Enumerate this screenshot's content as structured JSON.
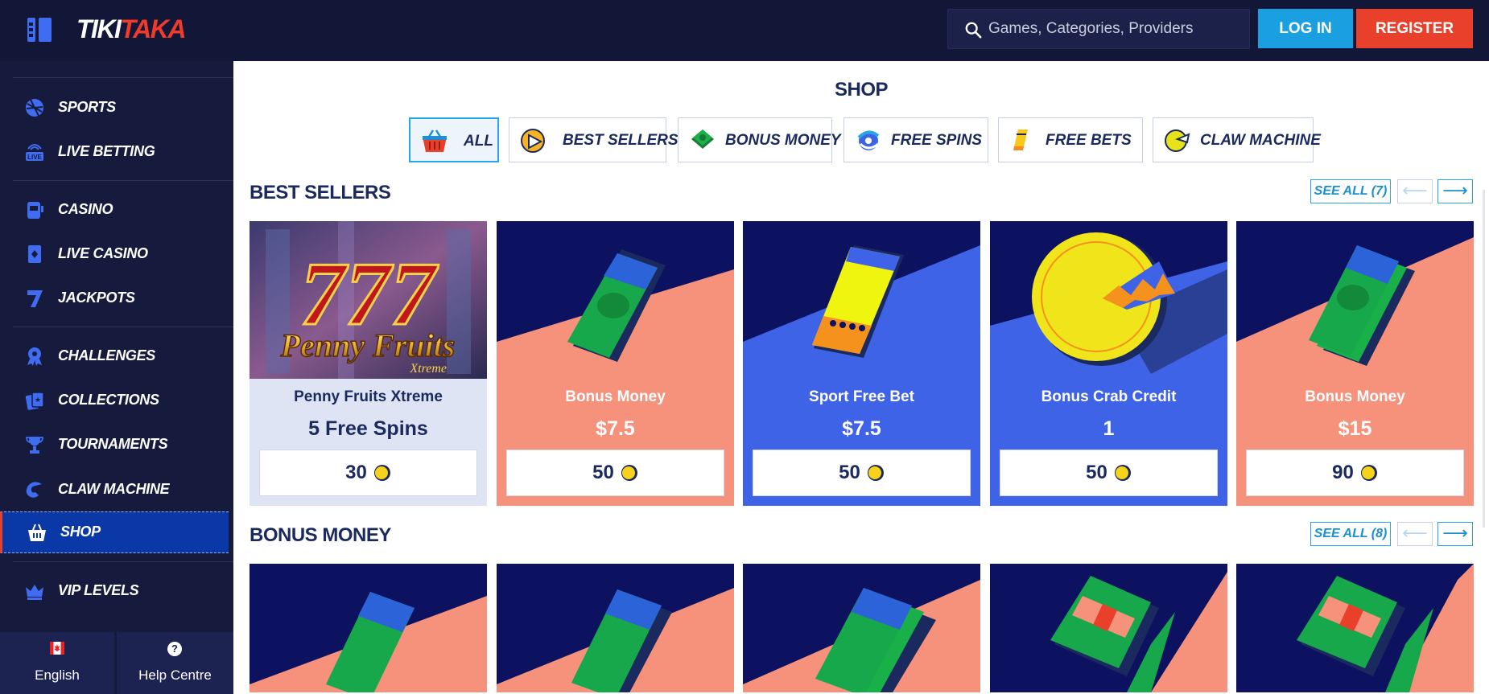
{
  "header": {
    "logo_part1": "TIKI",
    "logo_part2": "TAKA",
    "search_placeholder": "Games, Categories, Providers",
    "login_label": "LOG IN",
    "register_label": "REGISTER"
  },
  "sidebar": {
    "items": [
      {
        "label": "SPORTS",
        "icon": "sports-icon"
      },
      {
        "label": "LIVE BETTING",
        "icon": "live-betting-icon"
      },
      {
        "label": "CASINO",
        "icon": "casino-icon"
      },
      {
        "label": "LIVE CASINO",
        "icon": "live-casino-icon"
      },
      {
        "label": "JACKPOTS",
        "icon": "jackpots-icon"
      },
      {
        "label": "CHALLENGES",
        "icon": "challenges-icon"
      },
      {
        "label": "COLLECTIONS",
        "icon": "collections-icon"
      },
      {
        "label": "TOURNAMENTS",
        "icon": "tournaments-icon"
      },
      {
        "label": "CLAW MACHINE",
        "icon": "claw-machine-icon"
      },
      {
        "label": "SHOP",
        "icon": "shop-icon",
        "active": true
      },
      {
        "label": "VIP LEVELS",
        "icon": "vip-levels-icon"
      }
    ],
    "footer": {
      "language_label": "English",
      "help_label": "Help Centre",
      "help_glyph": "?"
    }
  },
  "main": {
    "title": "SHOP",
    "filters": [
      {
        "label": "ALL",
        "active": true
      },
      {
        "label": "BEST SELLERS"
      },
      {
        "label": "BONUS MONEY"
      },
      {
        "label": "FREE SPINS"
      },
      {
        "label": "FREE BETS"
      },
      {
        "label": "CLAW MACHINE"
      }
    ],
    "best_sellers": {
      "title": "BEST SELLERS",
      "see_all": "SEE ALL (7)",
      "cards": [
        {
          "name": "Penny Fruits Xtreme",
          "value": "5 Free Spins",
          "price": "30",
          "art_title": "Penny Fruits",
          "art_sub": "Xtreme",
          "art_num": "777"
        },
        {
          "name": "Bonus Money",
          "value": "$7.5",
          "price": "50"
        },
        {
          "name": "Sport Free Bet",
          "value": "$7.5",
          "price": "50"
        },
        {
          "name": "Bonus Crab Credit",
          "value": "1",
          "price": "50"
        },
        {
          "name": "Bonus Money",
          "value": "$15",
          "price": "90"
        }
      ]
    },
    "bonus_money": {
      "title": "BONUS MONEY",
      "see_all": "SEE ALL (8)"
    },
    "arrows": {
      "prev": "⟵",
      "next": "⟶"
    }
  },
  "colors": {
    "navy": "#121737",
    "sidebar": "#161b3d",
    "accent_blue": "#1aa0e0",
    "register_red": "#e8402a",
    "salmon": "#f6917c",
    "royal": "#3f63e6",
    "deep_navy": "#0c1160",
    "card_grey": "#dfe4f4"
  }
}
